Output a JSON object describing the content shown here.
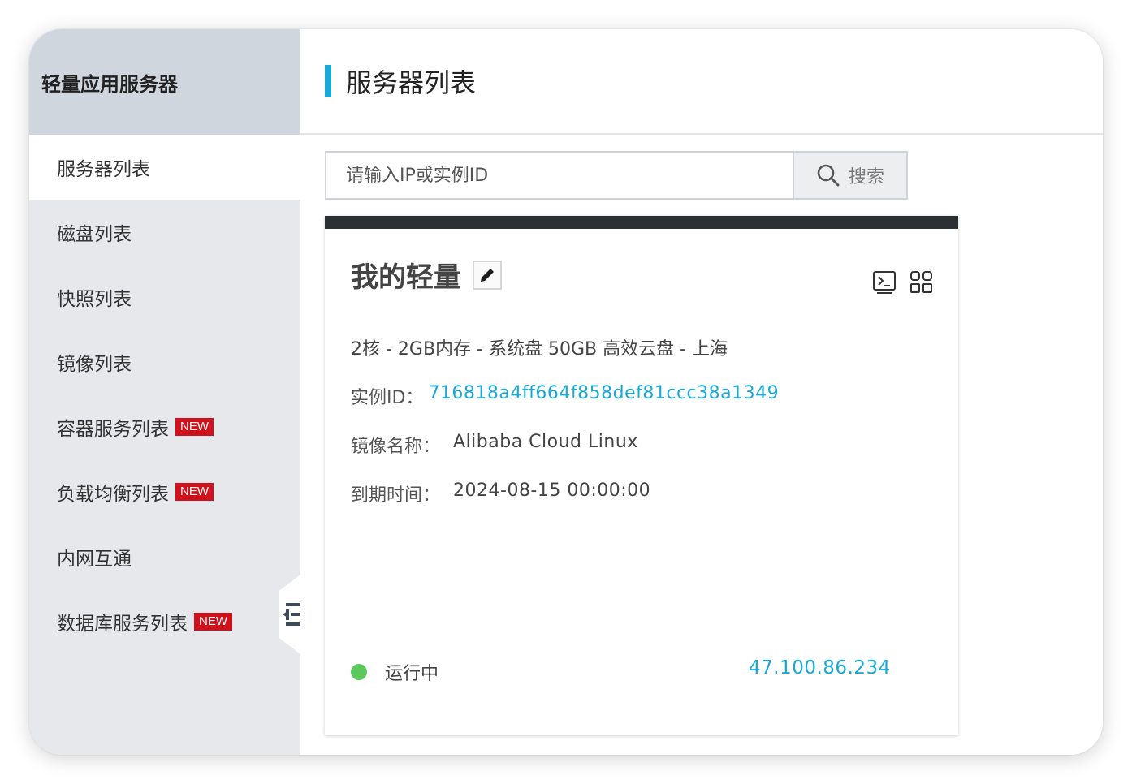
{
  "sidebar": {
    "title": "轻量应用服务器",
    "items": [
      {
        "label": "服务器列表",
        "active": true,
        "badge": ""
      },
      {
        "label": "磁盘列表",
        "badge": ""
      },
      {
        "label": "快照列表",
        "badge": ""
      },
      {
        "label": "镜像列表",
        "badge": ""
      },
      {
        "label": "容器服务列表",
        "badge": "NEW"
      },
      {
        "label": "负载均衡列表",
        "badge": "NEW"
      },
      {
        "label": "内网互通",
        "badge": ""
      },
      {
        "label": "数据库服务列表",
        "badge": "NEW"
      }
    ]
  },
  "main": {
    "title": "服务器列表",
    "search": {
      "placeholder": "请输入IP或实例ID",
      "button_label": "搜索"
    }
  },
  "card": {
    "name": "我的轻量",
    "spec": "2核 - 2GB内存 - 系统盘 50GB 高效云盘 - 上海",
    "instance_id_label": "实例ID：",
    "instance_id": "716818a4ff664f858def81ccc38a1349",
    "image_label": "镜像名称：",
    "image": "Alibaba Cloud Linux",
    "expire_label": "到期时间：",
    "expire": "2024-08-15 00:00:00",
    "status": "运行中",
    "ip": "47.100.86.234"
  },
  "colors": {
    "accent": "#1aa9d6",
    "badge": "#d0111b",
    "status_running": "#5ac85a"
  }
}
